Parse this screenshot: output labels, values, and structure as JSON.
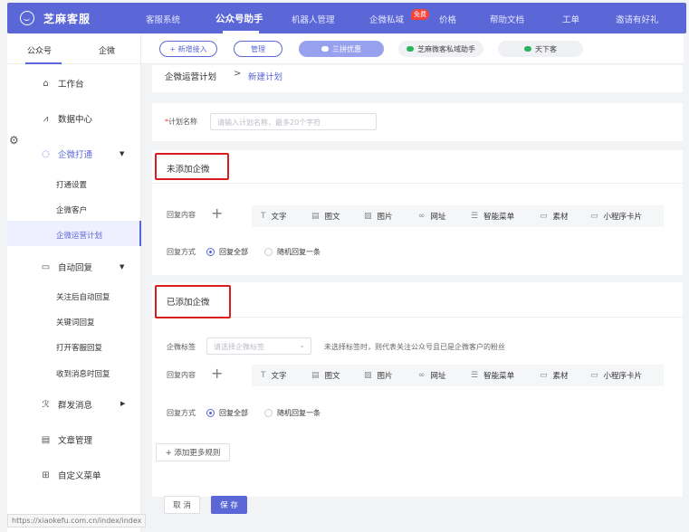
{
  "header": {
    "logo": "芝麻客服",
    "nav": [
      {
        "label": "客服系统"
      },
      {
        "label": "公众号助手"
      },
      {
        "label": "机器人管理"
      },
      {
        "label": "企微私域"
      },
      {
        "label": "价格"
      },
      {
        "label": "帮助文档"
      },
      {
        "label": "工单"
      },
      {
        "label": "邀请有好礼"
      }
    ],
    "free_badge": "免费",
    "accent": "#5b67d6"
  },
  "sidebar": {
    "tabs": [
      "公众号",
      "企微"
    ],
    "items": {
      "workbench": "工作台",
      "data_center": "数据中心",
      "wecom_connect": "企微打通",
      "connect_settings": "打通设置",
      "wecom_customers": "企微客户",
      "wecom_plan": "企微运营计划",
      "auto_reply": "自动回复",
      "follow_reply": "关注后自动回复",
      "keyword_reply": "关键词回复",
      "open_service_reply": "打开客服回复",
      "msg_reply": "收到消息时回复",
      "mass_msg": "群发消息",
      "article_mgmt": "文章管理",
      "custom_menu": "自定义菜单"
    },
    "status_url": "https://xiaokefu.com.cn/index/index"
  },
  "toolbar": {
    "add_access": "+ 新增接入",
    "manage": "管理",
    "accounts": [
      "三拼优惠",
      "芝麻微客私域助手",
      "天下客"
    ]
  },
  "breadcrumb": {
    "parent": "企微运营计划",
    "separator": ">",
    "current": "新建计划"
  },
  "form": {
    "plan_name_label": "计划名称",
    "plan_name_placeholder": "请输入计划名称，最多20个字符",
    "section_not_added": "未添加企微",
    "section_added": "已添加企微",
    "reply_content_label": "回复内容",
    "reply_method_label": "回复方式",
    "tag_label": "企微标签",
    "tag_placeholder": "请选择企微标签",
    "tag_hint": "未选择标签时，则代表关注公众号且已是企微客户的粉丝",
    "tools": [
      {
        "icon": "text-icon",
        "label": "文字"
      },
      {
        "icon": "image-text-icon",
        "label": "图文"
      },
      {
        "icon": "picture-icon",
        "label": "图片"
      },
      {
        "icon": "link-icon",
        "label": "网址"
      },
      {
        "icon": "menu-icon",
        "label": "智能菜单"
      },
      {
        "icon": "material-icon",
        "label": "素材"
      },
      {
        "icon": "mini-program-icon",
        "label": "小程序卡片"
      }
    ],
    "radio_all": "回复全部",
    "radio_random": "随机回复一条",
    "add_rule": "+ 添加更多规则",
    "cancel": "取 消",
    "save": "保 存"
  }
}
